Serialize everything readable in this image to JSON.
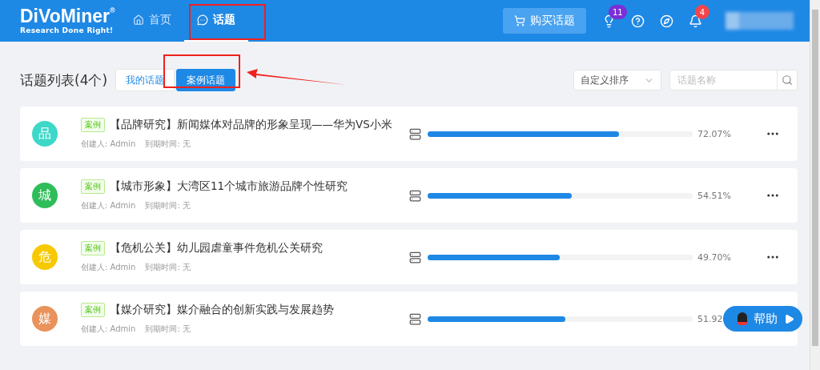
{
  "header": {
    "logo": {
      "name": "DiVoMiner",
      "registered": "®",
      "tagline": "Research Done Right!"
    },
    "nav": [
      {
        "label": "首页",
        "selected": false
      },
      {
        "label": "话题",
        "selected": true
      }
    ],
    "buy_button": "购买话题",
    "lightbulb_badge": {
      "count": "11",
      "color": "#7b2fd6"
    },
    "bell_badge": {
      "count": "4",
      "color": "#f5454b"
    }
  },
  "toolbar": {
    "title": "话题列表(4个)",
    "tabs": [
      {
        "label": "我的话题",
        "selected": false
      },
      {
        "label": "案例话题",
        "selected": true
      }
    ],
    "sort": "自定义排序",
    "search": {
      "placeholder": "话题名称"
    }
  },
  "topics": [
    {
      "avatar": "品",
      "color": "#3dd8c8",
      "tag": "案例",
      "title": "【品牌研究】新闻媒体对品牌的形象呈现——华为VS小米",
      "creator_label": "创建人:",
      "creator": "Admin",
      "expiry_label": "到期时间:",
      "expiry": "无",
      "level": 0.7207,
      "percent": "72.07%"
    },
    {
      "avatar": "城",
      "color": "#2fbd5a",
      "tag": "案例",
      "title": "【城市形象】大湾区11个城市旅游品牌个性研究",
      "creator_label": "创建人:",
      "creator": "Admin",
      "expiry_label": "到期时间:",
      "expiry": "无",
      "level": 0.5451,
      "percent": "54.51%"
    },
    {
      "avatar": "危",
      "color": "#f7c900",
      "tag": "案例",
      "title": "【危机公关】幼儿园虐童事件危机公关研究",
      "creator_label": "创建人:",
      "creator": "Admin",
      "expiry_label": "到期时间:",
      "expiry": "无",
      "level": 0.497,
      "percent": "49.70%"
    },
    {
      "avatar": "媒",
      "color": "#e9925b",
      "tag": "案例",
      "title": "【媒介研究】媒介融合的创新实践与发展趋势",
      "creator_label": "创建人:",
      "creator": "Admin",
      "expiry_label": "到期时间:",
      "expiry": "无",
      "level": 0.5192,
      "percent": "51.92"
    }
  ],
  "help_button": "帮助"
}
